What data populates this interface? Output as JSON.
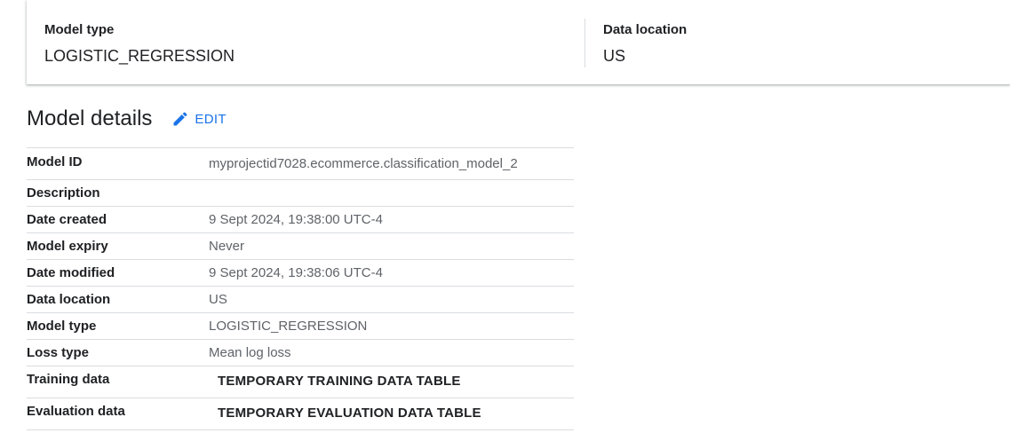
{
  "summary": {
    "model_type_label": "Model type",
    "model_type_value": "LOGISTIC_REGRESSION",
    "data_location_label": "Data location",
    "data_location_value": "US"
  },
  "details": {
    "title": "Model details",
    "edit_label": "EDIT",
    "edit_icon": "pencil-icon",
    "rows": [
      {
        "label": "Model ID",
        "value": "myprojectid7028.ecommerce.classification_model_2"
      },
      {
        "label": "Description",
        "value": ""
      },
      {
        "label": "Date created",
        "value": "9 Sept 2024, 19:38:00 UTC-4"
      },
      {
        "label": "Model expiry",
        "value": "Never"
      },
      {
        "label": "Date modified",
        "value": "9 Sept 2024, 19:38:06 UTC-4"
      },
      {
        "label": "Data location",
        "value": "US"
      },
      {
        "label": "Model type",
        "value": "LOGISTIC_REGRESSION"
      },
      {
        "label": "Loss type",
        "value": "Mean log loss"
      },
      {
        "label": "Training data",
        "value": "TEMPORARY TRAINING DATA TABLE"
      },
      {
        "label": "Evaluation data",
        "value": "TEMPORARY EVALUATION DATA TABLE"
      }
    ]
  },
  "colors": {
    "accent": "#1a73e8",
    "text": "#202124",
    "secondary_text": "#5f6368",
    "divider": "#dadce0"
  }
}
